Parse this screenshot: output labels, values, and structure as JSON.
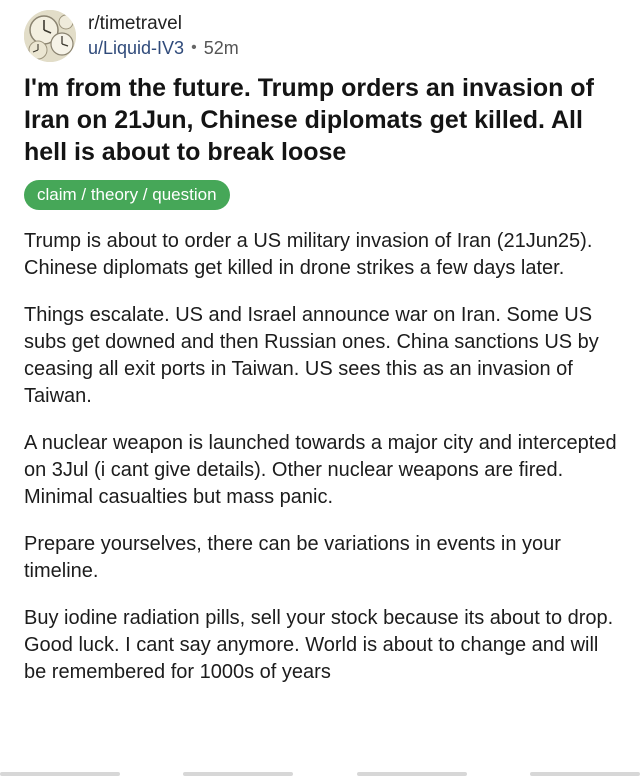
{
  "post": {
    "subreddit": "r/timetravel",
    "username": "u/Liquid-IV3",
    "separator": "•",
    "age": "52m",
    "avatar_icon": "clock-collage-avatar-icon",
    "title": "I'm from the future. Trump orders an invasion of Iran on 21Jun, Chinese diplomats get killed. All hell is about to break loose",
    "flair": {
      "label": "claim / theory / question",
      "color": "#46a758"
    },
    "paragraphs": [
      "Trump is about to order a US military invasion of Iran (21Jun25). Chinese diplomats get killed in drone strikes a few days later.",
      "Things escalate. US and Israel announce war on Iran. Some US subs get downed and then Russian ones. China sanctions US by ceasing all exit ports in Taiwan. US sees this as an invasion of Taiwan.",
      "A nuclear weapon is launched towards a major city and intercepted on 3Jul (i cant give details). Other nuclear weapons are fired. Minimal casualties but mass panic.",
      "Prepare yourselves, there can be variations in events in your timeline.",
      "Buy iodine radiation pills, sell your stock because its about to drop. Good luck. I cant say anymore. World is about to change and will be remembered for 1000s of years"
    ]
  }
}
